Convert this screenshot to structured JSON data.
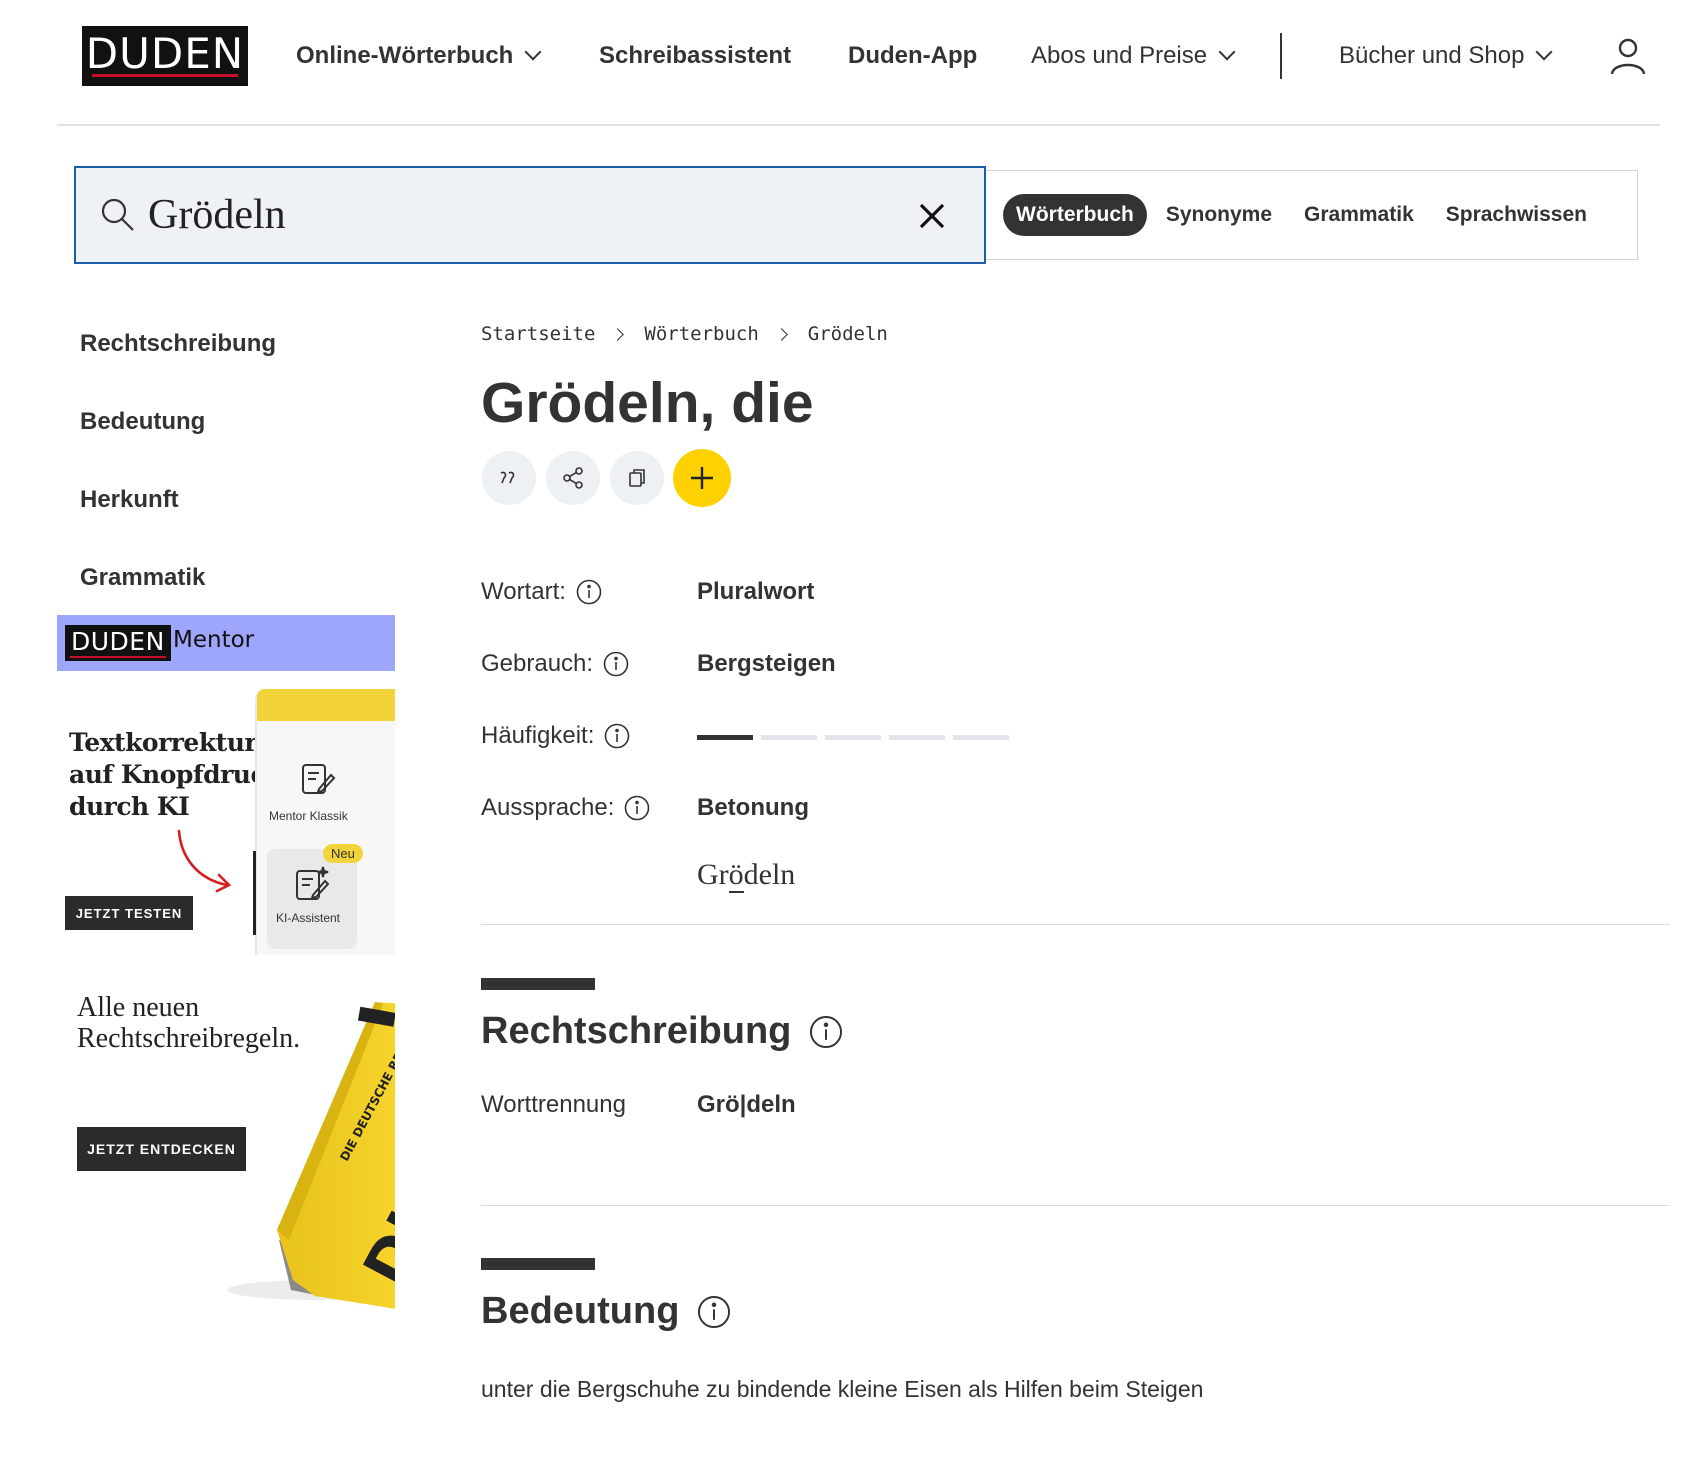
{
  "header": {
    "logo": "DUDEN",
    "nav": [
      {
        "label": "Online-Wörterbuch",
        "dropdown": true
      },
      {
        "label": "Schreibassistent",
        "dropdown": false
      },
      {
        "label": "Duden-App",
        "dropdown": false
      },
      {
        "label": "Abos und Preise",
        "dropdown": true
      },
      {
        "label": "Bücher und Shop",
        "dropdown": true
      }
    ],
    "icons": {
      "user": "user-icon",
      "chevron": "chevron-down-icon"
    }
  },
  "search": {
    "value": "Grödeln",
    "icons": {
      "search": "search-icon",
      "clear": "close-icon"
    },
    "tabs": [
      {
        "label": "Wörterbuch",
        "active": true
      },
      {
        "label": "Synonyme",
        "active": false
      },
      {
        "label": "Grammatik",
        "active": false
      },
      {
        "label": "Sprachwissen",
        "active": false
      }
    ]
  },
  "sidebar": {
    "items": [
      {
        "label": "Rechtschreibung"
      },
      {
        "label": "Bedeutung"
      },
      {
        "label": "Herkunft"
      },
      {
        "label": "Grammatik"
      }
    ]
  },
  "ads": {
    "mentor": {
      "logo": "DUDEN",
      "brand": "Mentor",
      "headline": "Textkorrekturen auf Knopfdruck durch KI",
      "panel_item_1": "Mentor Klassik",
      "panel_item_2": "KI-Assistent",
      "badge": "Neu",
      "cta": "JETZT TESTEN"
    },
    "book": {
      "headline_line1": "Alle neuen",
      "headline_line2": "Rechtschreibregeln.",
      "cta": "JETZT ENTDECKEN",
      "cover_text": "DIE DEUTSCHE RECHTSCHREIBUNG"
    }
  },
  "breadcrumb": [
    "Startseite",
    "Wörterbuch",
    "Grödeln"
  ],
  "entry": {
    "lemma": "Grödeln,",
    "article": "die",
    "actions": [
      "quote-icon",
      "share-icon",
      "copy-icon",
      "plus-icon"
    ],
    "properties": {
      "wortart_label": "Wortart:",
      "wortart_value": "Pluralwort",
      "gebrauch_label": "Gebrauch:",
      "gebrauch_value": "Bergsteigen",
      "haeufigkeit_label": "Häufigkeit:",
      "haeufigkeit_level": 1,
      "haeufigkeit_max": 5,
      "aussprache_label": "Aussprache:",
      "aussprache_value": "Betonung",
      "pronunciation_pre": "Gr",
      "pronunciation_stressed": "ö",
      "pronunciation_post": "deln"
    }
  },
  "sections": {
    "rechtschreibung": {
      "title": "Rechtschreibung",
      "worttrennung_label": "Worttrennung",
      "worttrennung_value": "Grö|deln"
    },
    "bedeutung": {
      "title": "Bedeutung",
      "text": "unter die Bergschuhe zu bindende kleine Eisen als Hilfen beim Steigen"
    }
  },
  "colors": {
    "accent_yellow": "#ffd100",
    "search_border": "#1d5bab",
    "dark": "#333333",
    "mentor_purple": "#9ea6fb",
    "duden_red": "#c8102e"
  }
}
